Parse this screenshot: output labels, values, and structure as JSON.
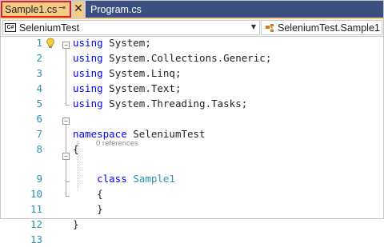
{
  "tabs": {
    "active": {
      "label": "Sample1.cs",
      "pin_glyph": "⊸",
      "close_glyph": "✕"
    },
    "inactive": {
      "label": "Program.cs"
    }
  },
  "nav": {
    "project": "SeleniumTest",
    "project_icon_text": "C#",
    "member": "SeleniumTest.Sample1",
    "dropdown_glyph": "▼"
  },
  "editor": {
    "collapse_glyph": "−",
    "lines": [
      {
        "num": "1",
        "tokens": [
          {
            "t": "using",
            "c": "kw"
          },
          {
            "t": " System;",
            "c": ""
          }
        ]
      },
      {
        "num": "2",
        "tokens": [
          {
            "t": "using",
            "c": "kw"
          },
          {
            "t": " System.Collections.Generic;",
            "c": ""
          }
        ]
      },
      {
        "num": "3",
        "tokens": [
          {
            "t": "using",
            "c": "kw"
          },
          {
            "t": " System.Linq;",
            "c": ""
          }
        ]
      },
      {
        "num": "4",
        "tokens": [
          {
            "t": "using",
            "c": "kw"
          },
          {
            "t": " System.Text;",
            "c": ""
          }
        ]
      },
      {
        "num": "5",
        "tokens": [
          {
            "t": "using",
            "c": "kw"
          },
          {
            "t": " System.Threading.Tasks;",
            "c": ""
          }
        ]
      },
      {
        "num": "6",
        "tokens": []
      },
      {
        "num": "7",
        "tokens": [
          {
            "t": "namespace",
            "c": "kw"
          },
          {
            "t": " SeleniumTest",
            "c": ""
          }
        ]
      },
      {
        "num": "8",
        "tokens": [
          {
            "t": "{",
            "c": ""
          }
        ]
      },
      {
        "num": "9",
        "tokens": [
          {
            "t": "    ",
            "c": ""
          },
          {
            "t": "class",
            "c": "kw"
          },
          {
            "t": " ",
            "c": ""
          },
          {
            "t": "Sample1",
            "c": "ty"
          }
        ]
      },
      {
        "num": "10",
        "tokens": [
          {
            "t": "    {",
            "c": ""
          }
        ]
      },
      {
        "num": "11",
        "tokens": [
          {
            "t": "    }",
            "c": ""
          }
        ]
      },
      {
        "num": "12",
        "tokens": [
          {
            "t": "}",
            "c": ""
          }
        ]
      },
      {
        "num": "13",
        "tokens": []
      }
    ],
    "codelens": "0 references"
  }
}
